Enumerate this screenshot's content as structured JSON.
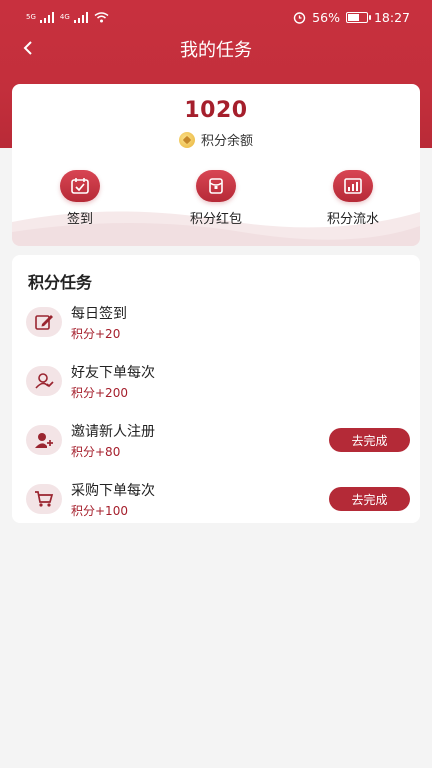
{
  "status_bar": {
    "network_left": "5G",
    "network_right": "4G",
    "battery": "56%",
    "time": "18:27"
  },
  "nav": {
    "title": "我的任务"
  },
  "points": {
    "value": "1020",
    "label": "积分余额"
  },
  "quick_actions": [
    {
      "label": "签到",
      "icon": "calendar-check-icon"
    },
    {
      "label": "积分红包",
      "icon": "red-packet-icon"
    },
    {
      "label": "积分流水",
      "icon": "bar-chart-icon"
    }
  ],
  "tasks": {
    "title": "积分任务",
    "items": [
      {
        "name": "每日签到",
        "points": "积分+20",
        "icon": "edit-icon",
        "button": ""
      },
      {
        "name": "好友下单每次",
        "points": "积分+200",
        "icon": "user-check-icon",
        "button": ""
      },
      {
        "name": "邀请新人注册",
        "points": "积分+80",
        "icon": "user-add-icon",
        "button": "去完成"
      },
      {
        "name": "采购下单每次",
        "points": "积分+100",
        "icon": "cart-icon",
        "button": "去完成"
      }
    ]
  },
  "colors": {
    "brand": "#c32f3c",
    "accent": "#a51f2c",
    "background": "#f4f4f4"
  }
}
